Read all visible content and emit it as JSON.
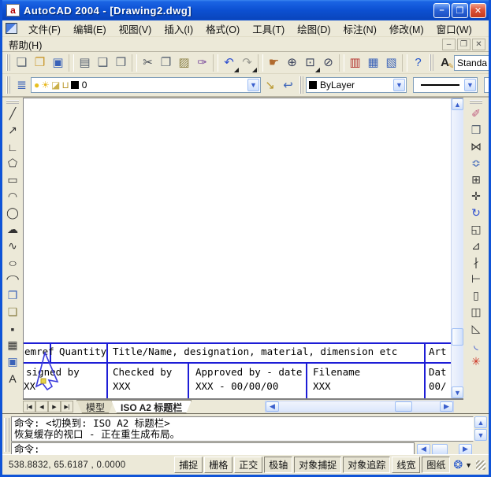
{
  "window": {
    "title": "AutoCAD 2004 - [Drawing2.dwg]",
    "controls": {
      "minimize": "–",
      "maximize": "❐",
      "close": "✕"
    }
  },
  "menu": {
    "row1": [
      "文件(F)",
      "编辑(E)",
      "视图(V)",
      "插入(I)",
      "格式(O)",
      "工具(T)",
      "绘图(D)",
      "标注(N)",
      "修改(M)",
      "窗口(W)"
    ],
    "row2": [
      "帮助(H)"
    ],
    "mdi": {
      "minimize": "–",
      "restore": "❐",
      "close": "✕"
    }
  },
  "toolbars": {
    "standard": [
      {
        "name": "new-file-icon",
        "glyph": "❏",
        "color": "#556070"
      },
      {
        "name": "open-icon",
        "glyph": "❐",
        "color": "#c9972b"
      },
      {
        "name": "save-icon",
        "glyph": "▣",
        "color": "#3a62b8"
      },
      {
        "name": "sep",
        "sep": true
      },
      {
        "name": "plot-icon",
        "glyph": "▤",
        "color": "#556070"
      },
      {
        "name": "plot-preview-icon",
        "glyph": "❑",
        "color": "#556070"
      },
      {
        "name": "publish-icon",
        "glyph": "❒",
        "color": "#556070"
      },
      {
        "name": "sep",
        "sep": true
      },
      {
        "name": "cut-icon",
        "glyph": "✂",
        "color": "#444a55"
      },
      {
        "name": "copy-icon",
        "glyph": "❐",
        "color": "#556070"
      },
      {
        "name": "paste-icon",
        "glyph": "▨",
        "color": "#8a7f45"
      },
      {
        "name": "match-properties-icon",
        "glyph": "✑",
        "color": "#7a4a9c"
      },
      {
        "name": "sep",
        "sep": true
      },
      {
        "name": "undo-icon",
        "glyph": "↶",
        "color": "#2e4fd0",
        "dropdown": true
      },
      {
        "name": "redo-icon",
        "glyph": "↷",
        "color": "#9a9a92",
        "dropdown": true
      },
      {
        "name": "sep",
        "sep": true
      },
      {
        "name": "pan-realtime-icon",
        "glyph": "☛",
        "color": "#b06a2e"
      },
      {
        "name": "zoom-realtime-icon",
        "glyph": "⊕",
        "color": "#39415a"
      },
      {
        "name": "zoom-window-icon",
        "glyph": "⊡",
        "color": "#39415a",
        "dropdown": true
      },
      {
        "name": "zoom-previous-icon",
        "glyph": "⊘",
        "color": "#39415a"
      },
      {
        "name": "sep",
        "sep": true
      },
      {
        "name": "properties-icon",
        "glyph": "▥",
        "color": "#b3322e"
      },
      {
        "name": "designcenter-icon",
        "glyph": "▦",
        "color": "#3a62b8"
      },
      {
        "name": "tool-palettes-icon",
        "glyph": "▧",
        "color": "#3a62b8"
      },
      {
        "name": "sep",
        "sep": true
      },
      {
        "name": "help-icon",
        "glyph": "?",
        "color": "#2255cc"
      }
    ],
    "styles": {
      "text_style_icon": "A",
      "text_style_value": "Standa"
    },
    "layers": {
      "layers_icon": "≣",
      "bulb_icon": "●",
      "sun_icon": "☀",
      "freeze_icon": "◪",
      "lock_icon": "⊔",
      "current_layer": "0",
      "make_current_icon": "↘",
      "layer_previous_icon": "↩"
    },
    "properties": {
      "color_value": "ByLayer"
    }
  },
  "draw_toolbar": [
    {
      "name": "line-icon",
      "glyph": "╱",
      "color": "#333"
    },
    {
      "name": "construction-line-icon",
      "glyph": "↗",
      "color": "#333"
    },
    {
      "name": "polyline-icon",
      "glyph": "∟",
      "color": "#333"
    },
    {
      "name": "polygon-icon",
      "glyph": "⬠",
      "color": "#333"
    },
    {
      "name": "rectangle-icon",
      "glyph": "▭",
      "color": "#333"
    },
    {
      "name": "arc-icon",
      "glyph": "◠",
      "color": "#333"
    },
    {
      "name": "circle-icon",
      "glyph": "◯",
      "color": "#333"
    },
    {
      "name": "revcloud-icon",
      "glyph": "☁",
      "color": "#333"
    },
    {
      "name": "spline-icon",
      "glyph": "∿",
      "color": "#333"
    },
    {
      "name": "ellipse-icon",
      "glyph": "○",
      "color": "#333",
      "cls": "wide"
    },
    {
      "name": "ellipse-arc-icon",
      "glyph": "◠",
      "color": "#333",
      "cls": "wide"
    },
    {
      "name": "insert-block-icon",
      "glyph": "❐",
      "color": "#3a62b8"
    },
    {
      "name": "make-block-icon",
      "glyph": "❏",
      "color": "#8a7f45"
    },
    {
      "name": "point-icon",
      "glyph": "▪",
      "color": "#333"
    },
    {
      "name": "hatch-icon",
      "glyph": "▦",
      "color": "#333"
    },
    {
      "name": "region-icon",
      "glyph": "▣",
      "color": "#3a62b8"
    },
    {
      "name": "mtext-icon",
      "glyph": "A",
      "color": "#222"
    }
  ],
  "modify_toolbar": [
    {
      "name": "erase-icon",
      "glyph": "✐",
      "color": "#c06080"
    },
    {
      "name": "copy-object-icon",
      "glyph": "❒",
      "color": "#556070"
    },
    {
      "name": "mirror-icon",
      "glyph": "⋈",
      "color": "#333"
    },
    {
      "name": "offset-icon",
      "glyph": "≎",
      "color": "#3a62b8"
    },
    {
      "name": "array-icon",
      "glyph": "⊞",
      "color": "#333"
    },
    {
      "name": "move-icon",
      "glyph": "✛",
      "color": "#333"
    },
    {
      "name": "rotate-icon",
      "glyph": "↻",
      "color": "#2e4fd0"
    },
    {
      "name": "scale-icon",
      "glyph": "◱",
      "color": "#333"
    },
    {
      "name": "stretch-icon",
      "glyph": "⊿",
      "color": "#333"
    },
    {
      "name": "trim-icon",
      "glyph": "∤",
      "color": "#333"
    },
    {
      "name": "extend-icon",
      "glyph": "⊢",
      "color": "#333"
    },
    {
      "name": "break-at-point-icon",
      "glyph": "▯",
      "color": "#333"
    },
    {
      "name": "break-icon",
      "glyph": "◫",
      "color": "#333"
    },
    {
      "name": "chamfer-icon",
      "glyph": "◺",
      "color": "#333"
    },
    {
      "name": "fillet-icon",
      "glyph": "◟",
      "color": "#2e4fd0"
    },
    {
      "name": "explode-icon",
      "glyph": "✳",
      "color": "#cc3322"
    }
  ],
  "titleblock": {
    "row1": {
      "itemref": "emref",
      "quantity": "Quantity",
      "title": "Title/Name, designation, material, dimension etc",
      "article": "Art"
    },
    "row2": {
      "designed": "signed by",
      "designed_value": "XX",
      "checked": "Checked by",
      "checked_value": "XXX",
      "approved": "Approved by - date",
      "approved_value": "XXX - 00/00/00",
      "filename": "Filename",
      "filename_value": "XXX",
      "date": "Dat",
      "date_value": "00/"
    }
  },
  "tabs": {
    "nav": [
      "|◀",
      "◀",
      "▶",
      "▶|"
    ],
    "items": [
      {
        "name": "tab-model",
        "label": "模型",
        "active": false
      },
      {
        "name": "tab-iso-a2-titleblock",
        "label": "ISO A2 标题栏",
        "active": true
      }
    ]
  },
  "command": {
    "history_line1": "命令: <切换到: ISO A2 标题栏>",
    "history_line2": "恢复缓存的视口 - 正在重生成布局。",
    "prompt": "命令:"
  },
  "statusbar": {
    "coords": "538.8832, 65.6187 , 0.0000",
    "toggles": [
      {
        "name": "toggle-snap",
        "label": "捕捉",
        "pressed": false
      },
      {
        "name": "toggle-grid",
        "label": "栅格",
        "pressed": false
      },
      {
        "name": "toggle-ortho",
        "label": "正交",
        "pressed": false
      },
      {
        "name": "toggle-polar",
        "label": "极轴",
        "pressed": true
      },
      {
        "name": "toggle-osnap",
        "label": "对象捕捉",
        "pressed": true
      },
      {
        "name": "toggle-otrack",
        "label": "对象追踪",
        "pressed": true
      },
      {
        "name": "toggle-lineweight",
        "label": "线宽",
        "pressed": false
      },
      {
        "name": "toggle-paper",
        "label": "图纸",
        "pressed": true
      }
    ],
    "communication_icon": "❂",
    "caret": "▼"
  },
  "colors": {
    "titlebar_blue": "#0c50d2",
    "window_border": "#0f54d7",
    "toolbar_bg": "#ECE9D8",
    "table_line_blue": "#1d1dd6",
    "scroll_accent": "#3a5fcd"
  }
}
